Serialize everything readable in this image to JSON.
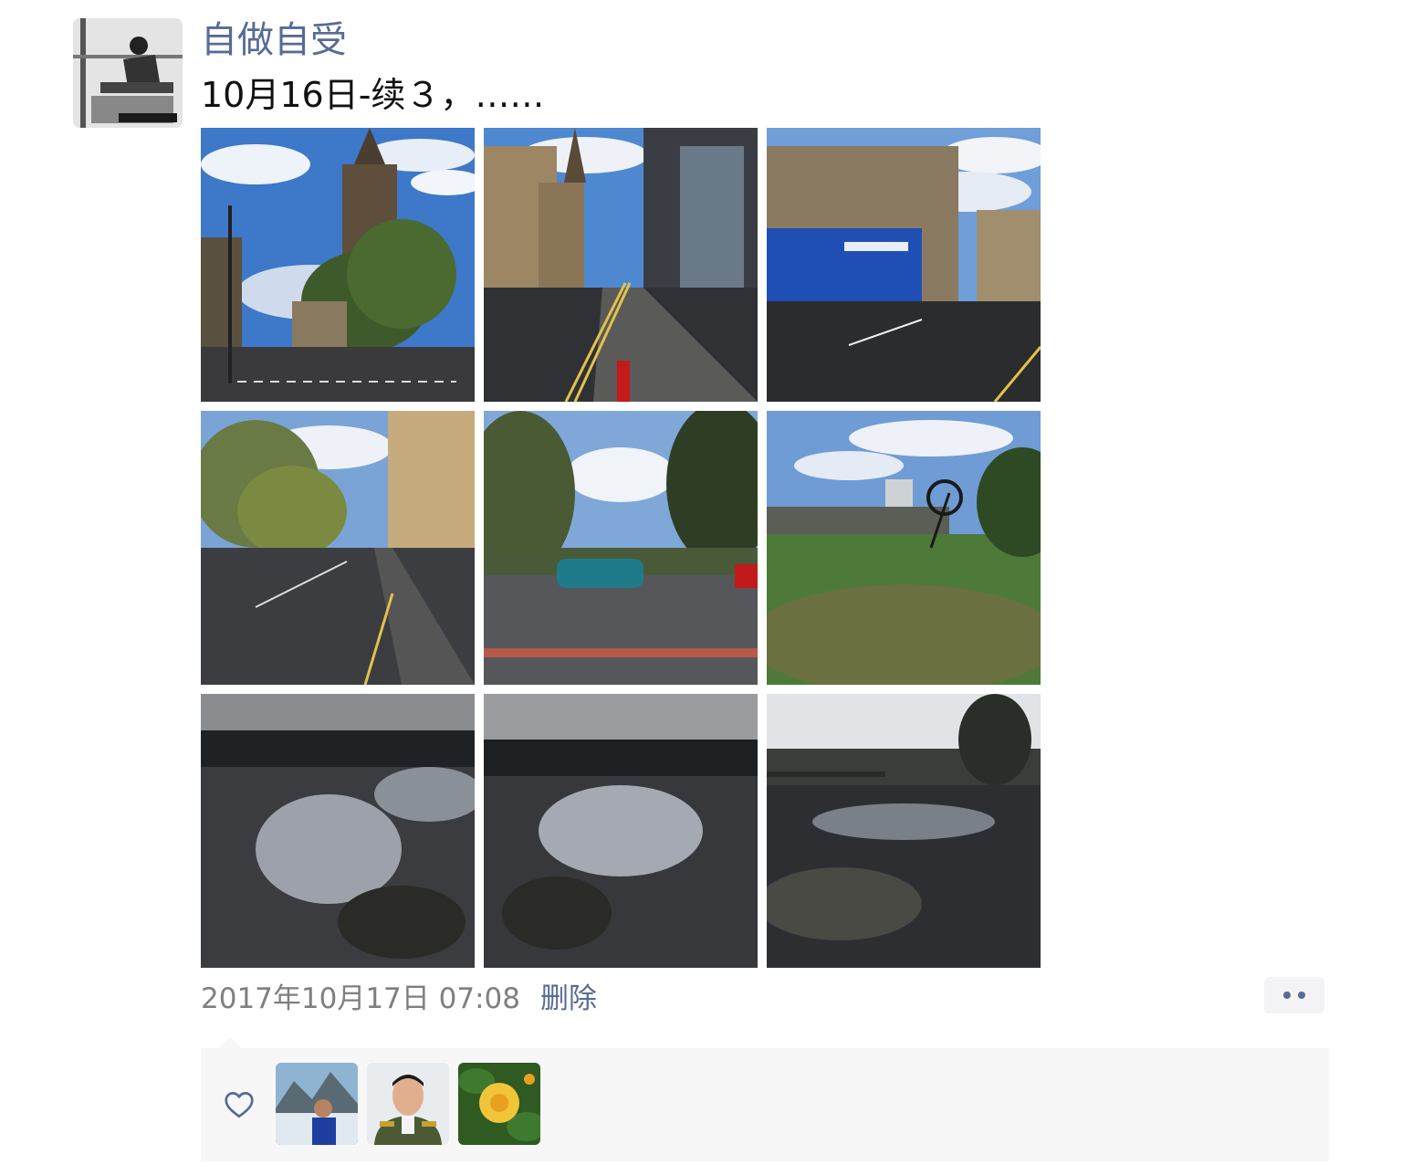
{
  "post": {
    "author": "自做自受",
    "text": "10月16日-续３，……",
    "timestamp": "2017年10月17日 07:08",
    "delete_label": "删除"
  },
  "photos": [
    {
      "name": "photo-church-street"
    },
    {
      "name": "photo-high-street"
    },
    {
      "name": "photo-fitness-corner"
    },
    {
      "name": "photo-road-trees"
    },
    {
      "name": "photo-car-park"
    },
    {
      "name": "photo-river-green"
    },
    {
      "name": "photo-river-1"
    },
    {
      "name": "photo-river-2"
    },
    {
      "name": "photo-river-bridge"
    }
  ],
  "likes": {
    "icon": "heart-outline-icon",
    "likers": [
      {
        "name": "liker-avatar-1"
      },
      {
        "name": "liker-avatar-2"
      },
      {
        "name": "liker-avatar-3"
      }
    ]
  },
  "colors": {
    "link": "#576b95",
    "timestamp": "#7f7f7f",
    "panel": "#f7f7f7"
  }
}
